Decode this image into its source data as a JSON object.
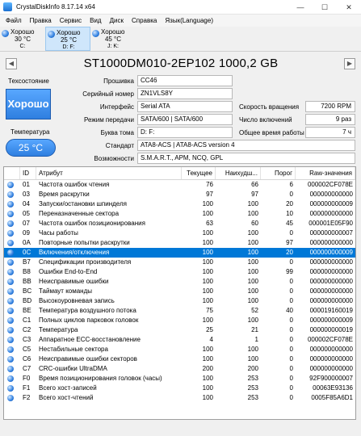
{
  "window": {
    "title": "CrystalDiskInfo 8.17.14 x64",
    "min": "—",
    "max": "☐",
    "close": "✕"
  },
  "menu": [
    "Файл",
    "Правка",
    "Сервис",
    "Вид",
    "Диск",
    "Справка",
    "Язык(Language)"
  ],
  "drives": [
    {
      "status": "Хорошо",
      "temp": "30 °C",
      "letter": "C:"
    },
    {
      "status": "Хорошо",
      "temp": "25 °C",
      "letter": "D: F:"
    },
    {
      "status": "Хорошо",
      "temp": "45 °C",
      "letter": "J: K:"
    }
  ],
  "model": "ST1000DM010-2EP102 1000,2 GB",
  "health": {
    "label": "Техсостояние",
    "value": "Хорошо"
  },
  "temperature": {
    "label": "Температура",
    "value": "25 °C"
  },
  "info": {
    "firmware": {
      "label": "Прошивка",
      "value": "CC46"
    },
    "serial": {
      "label": "Серийный номер",
      "value": "ZN1VLS8Y"
    },
    "interface": {
      "label": "Интерфейс",
      "value": "Serial ATA"
    },
    "transfer": {
      "label": "Режим передачи",
      "value": "SATA/600 | SATA/600"
    },
    "drive_letter": {
      "label": "Буква тома",
      "value": "D: F:"
    },
    "standard": {
      "label": "Стандарт",
      "value": "ATA8-ACS | ATA8-ACS version 4"
    },
    "features": {
      "label": "Возможности",
      "value": "S.M.A.R.T., APM, NCQ, GPL"
    },
    "rotation": {
      "label": "Скорость вращения",
      "value": "7200 RPM"
    },
    "power_on_count": {
      "label": "Число включений",
      "value": "9 раз"
    },
    "power_on_hours": {
      "label": "Общее время работы",
      "value": "7 ч"
    }
  },
  "table": {
    "headers": [
      "",
      "ID",
      "Атрибут",
      "Текущее",
      "Наихудш...",
      "Порог",
      "Raw-значения"
    ],
    "rows": [
      [
        "01",
        "Частота ошибок чтения",
        "76",
        "66",
        "6",
        "000002CF078E"
      ],
      [
        "03",
        "Время раскрутки",
        "97",
        "97",
        "0",
        "000000000000"
      ],
      [
        "04",
        "Запуски/остановки шпинделя",
        "100",
        "100",
        "20",
        "000000000009"
      ],
      [
        "05",
        "Переназначенные сектора",
        "100",
        "100",
        "10",
        "000000000000"
      ],
      [
        "07",
        "Частота ошибок позиционирования",
        "63",
        "60",
        "45",
        "000001E05F90"
      ],
      [
        "09",
        "Часы работы",
        "100",
        "100",
        "0",
        "000000000007"
      ],
      [
        "0A",
        "Повторные попытки раскрутки",
        "100",
        "100",
        "97",
        "000000000000"
      ],
      [
        "0C",
        "Включения/отключения",
        "100",
        "100",
        "20",
        "000000000009"
      ],
      [
        "B7",
        "Спецификации производителя",
        "100",
        "100",
        "0",
        "000000000000"
      ],
      [
        "B8",
        "Ошибки End-to-End",
        "100",
        "100",
        "99",
        "000000000000"
      ],
      [
        "BB",
        "Неисправимые ошибки",
        "100",
        "100",
        "0",
        "000000000000"
      ],
      [
        "BC",
        "Таймаут команды",
        "100",
        "100",
        "0",
        "000000000000"
      ],
      [
        "BD",
        "Высокоуровневая запись",
        "100",
        "100",
        "0",
        "000000000000"
      ],
      [
        "BE",
        "Температура воздушного потока",
        "75",
        "52",
        "40",
        "000019160019"
      ],
      [
        "C1",
        "Полных циклов парковок головок",
        "100",
        "100",
        "0",
        "000000000009"
      ],
      [
        "C2",
        "Температура",
        "25",
        "21",
        "0",
        "000000000019"
      ],
      [
        "C3",
        "Аппаратное ECC-восстановление",
        "4",
        "1",
        "0",
        "000002CF078E"
      ],
      [
        "C5",
        "Нестабильные сектора",
        "100",
        "100",
        "0",
        "000000000000"
      ],
      [
        "C6",
        "Неисправимые ошибки секторов",
        "100",
        "100",
        "0",
        "000000000000"
      ],
      [
        "C7",
        "CRC-ошибки UltraDMA",
        "200",
        "200",
        "0",
        "000000000000"
      ],
      [
        "F0",
        "Время позиционирования головок (часы)",
        "100",
        "253",
        "0",
        "92F900000007"
      ],
      [
        "F1",
        "Всего хост-записей",
        "100",
        "253",
        "0",
        "00063E93136"
      ],
      [
        "F2",
        "Всего хост-чтений",
        "100",
        "253",
        "0",
        "0005F85A6D1"
      ]
    ],
    "selected_row": 7
  }
}
